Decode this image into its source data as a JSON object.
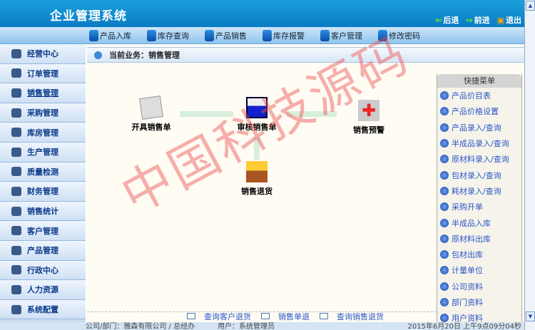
{
  "header": {
    "title": "企业管理系统",
    "back": "后退",
    "forward": "前进",
    "exit": "退出"
  },
  "nav": [
    "产品入库",
    "库存查询",
    "产品销售",
    "库存报警",
    "客户管理",
    "修改密码"
  ],
  "sidebar": [
    "经营中心",
    "订单管理",
    "销售管理",
    "采购管理",
    "库房管理",
    "生产管理",
    "质量检测",
    "财务管理",
    "销售统计",
    "客户管理",
    "产品管理",
    "行政中心",
    "人力资源",
    "系统配置"
  ],
  "breadcrumb": "当前业务：销售管理",
  "flow": {
    "create": "开具销售单",
    "review": "审核销售单",
    "alert": "销售预警",
    "return": "销售退货"
  },
  "quick_menu": {
    "title": "快捷菜单",
    "items": [
      "产品价目表",
      "产品价格设置",
      "产品录入/查询",
      "半成品录入/查询",
      "原材料录入/查询",
      "包材录入/查询",
      "耗材录入/查询",
      "采购开单",
      "半成品入库",
      "原材料出库",
      "包材出库",
      "计量单位",
      "公司资料",
      "部门资料",
      "用户资料"
    ]
  },
  "bottom_links": [
    "查询客户退货",
    "销售单退",
    "查询销售退货"
  ],
  "status": {
    "company": "公司/部门：雅森有限公司 / 总经办",
    "user": "用户：系统管理员",
    "time": "2015年6月20日 上午9点09分04秒"
  },
  "watermark": "中国科技源码"
}
